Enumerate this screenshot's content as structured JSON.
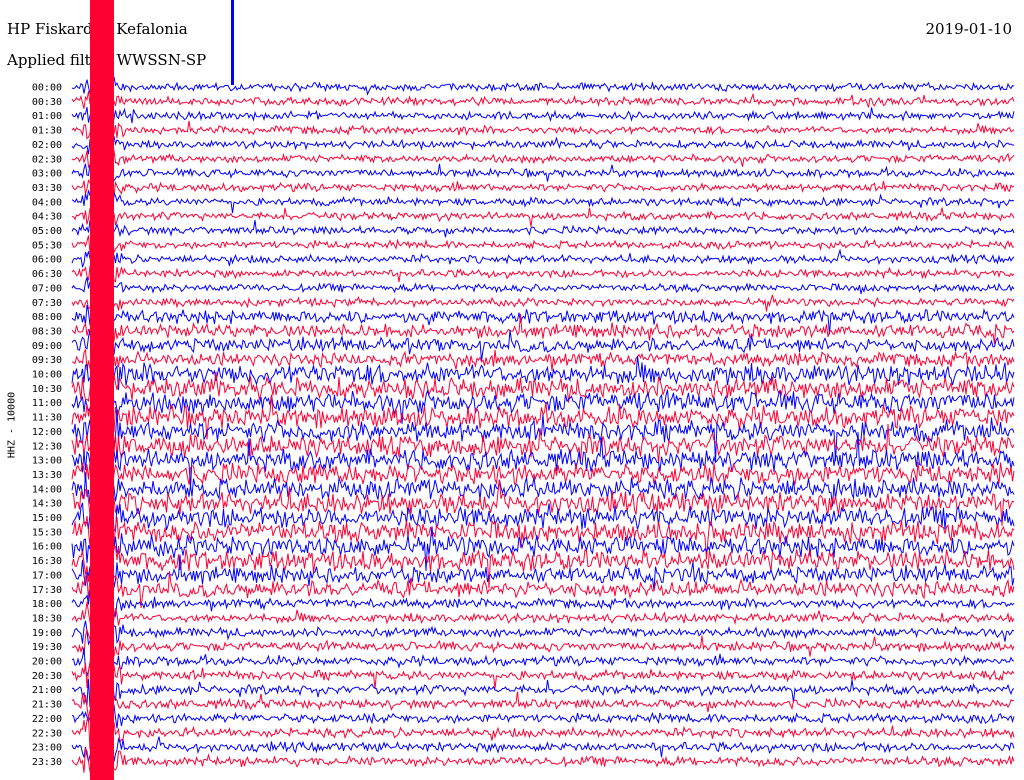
{
  "chart_data": {
    "type": "line",
    "title": "HP Fiskardo - Kefalonia",
    "date": "2019-01-10",
    "filter_label": "Applied filter: WWSSN-SP",
    "ylabel": "HHZ - 10000",
    "tick_labels": [
      "00:00",
      "00:30",
      "01:00",
      "01:30",
      "02:00",
      "02:30",
      "03:00",
      "03:30",
      "04:00",
      "04:30",
      "05:00",
      "05:30",
      "06:00",
      "06:30",
      "07:00",
      "07:30",
      "08:00",
      "08:30",
      "09:00",
      "09:30",
      "10:00",
      "10:30",
      "11:00",
      "11:30",
      "12:00",
      "12:30",
      "13:00",
      "13:30",
      "14:00",
      "14:30",
      "15:00",
      "15:30",
      "16:00",
      "16:30",
      "17:00",
      "17:30",
      "18:00",
      "18:30",
      "19:00",
      "19:30",
      "20:00",
      "20:30",
      "21:00",
      "21:30",
      "22:00",
      "22:30",
      "23:00",
      "23:30"
    ],
    "series_colors": [
      "#0000ff",
      "#ff0033"
    ],
    "grid": false
  }
}
